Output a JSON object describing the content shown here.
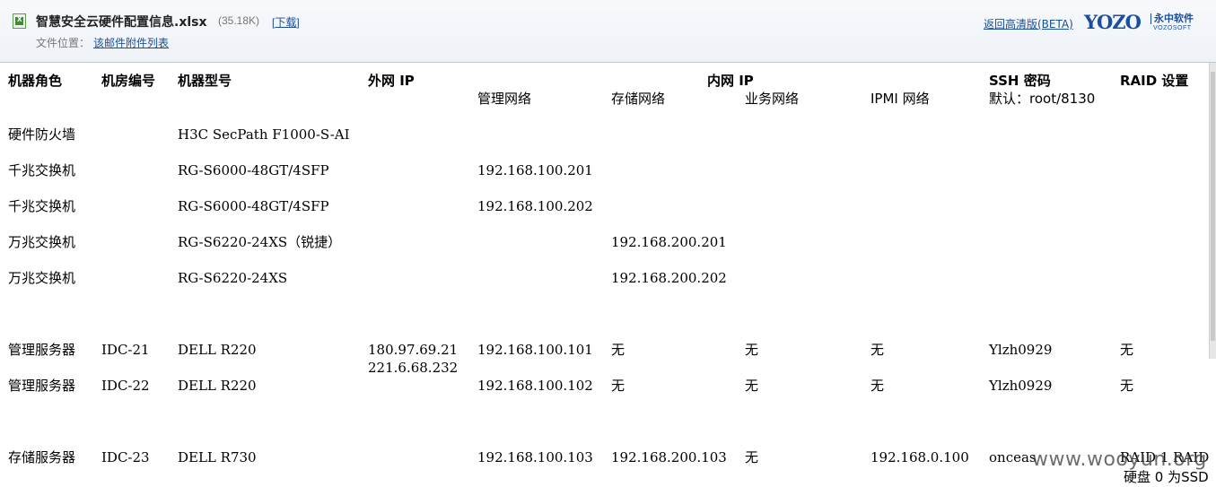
{
  "header": {
    "filename": "智慧安全云硬件配置信息.xlsx",
    "filesize": "(35.18K)",
    "download_label": "下载",
    "location_label": "文件位置：",
    "location_link": "该邮件附件列表",
    "hd_link": "返回高清版(BETA)",
    "brand": "YOZO",
    "brand_cn": "永中软件",
    "brand_en": "VOZOSOFT"
  },
  "table": {
    "headers": {
      "role": "机器角色",
      "room": "机房编号",
      "model": "机器型号",
      "wan_ip": "外网 IP",
      "lan_ip": "内网 IP",
      "ssh": "SSH 密码",
      "raid": "RAID 设置"
    },
    "subheaders": {
      "mgmt": "管理网络",
      "storage": "存储网络",
      "business": "业务网络",
      "ipmi": "IPMI 网络",
      "ssh_default": "默认：root/8130"
    },
    "rows": [
      {
        "role": "硬件防火墙",
        "room": "",
        "model": "H3C SecPath F1000-S-AI",
        "wan": "",
        "wan2": "",
        "mgmt": "",
        "storage": "",
        "business": "",
        "ipmi": "",
        "ssh": "",
        "raid": "",
        "raid2": ""
      },
      {
        "role": "千兆交换机",
        "room": "",
        "model": "RG-S6000-48GT/4SFP",
        "wan": "",
        "wan2": "",
        "mgmt": "192.168.100.201",
        "storage": "",
        "business": "",
        "ipmi": "",
        "ssh": "",
        "raid": "",
        "raid2": ""
      },
      {
        "role": "千兆交换机",
        "room": "",
        "model": "RG-S6000-48GT/4SFP",
        "wan": "",
        "wan2": "",
        "mgmt": "192.168.100.202",
        "storage": "",
        "business": "",
        "ipmi": "",
        "ssh": "",
        "raid": "",
        "raid2": ""
      },
      {
        "role": "万兆交换机",
        "room": "",
        "model": "RG-S6220-24XS（锐捷）",
        "wan": "",
        "wan2": "",
        "mgmt": "",
        "storage": "192.168.200.201",
        "business": "",
        "ipmi": "",
        "ssh": "",
        "raid": "",
        "raid2": ""
      },
      {
        "role": "万兆交换机",
        "room": "",
        "model": "RG-S6220-24XS",
        "wan": "",
        "wan2": "",
        "mgmt": "",
        "storage": "192.168.200.202",
        "business": "",
        "ipmi": "",
        "ssh": "",
        "raid": "",
        "raid2": ""
      },
      {
        "role": "管理服务器",
        "room": "IDC-21",
        "model": "DELL R220",
        "wan": "180.97.69.21",
        "wan2": "221.6.68.232",
        "mgmt": "192.168.100.101",
        "storage": "无",
        "business": "无",
        "ipmi": "无",
        "ssh": "Ylzh0929",
        "raid": "无",
        "raid2": ""
      },
      {
        "role": "管理服务器",
        "room": "IDC-22",
        "model": "DELL R220",
        "wan": "",
        "wan2": "",
        "mgmt": "192.168.100.102",
        "storage": "无",
        "business": "无",
        "ipmi": "无",
        "ssh": "Ylzh0929",
        "raid": "无",
        "raid2": ""
      },
      {
        "role": "存储服务器",
        "room": "IDC-23",
        "model": "DELL R730",
        "wan": "",
        "wan2": "",
        "mgmt": "192.168.100.103",
        "storage": "192.168.200.103",
        "business": "无",
        "ipmi": "192.168.0.100",
        "ssh": "onceas",
        "raid": "RAID 1 RAID",
        "raid2": "硬盘 0 为SSD"
      }
    ]
  },
  "watermark": "www.wooyun.org"
}
